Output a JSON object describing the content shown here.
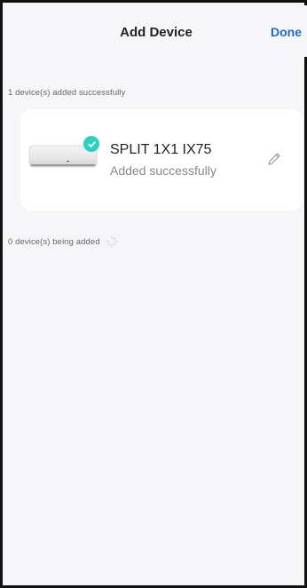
{
  "header": {
    "title": "Add Device",
    "done_label": "Done"
  },
  "success_section": {
    "label": "1 device(s) added successfully",
    "devices": [
      {
        "name": "SPLIT 1X1 IX75",
        "status": "Added successfully",
        "icon": "air-conditioner-icon"
      }
    ]
  },
  "adding_section": {
    "label": "0 device(s) being added"
  },
  "colors": {
    "accent": "#1f6cc8",
    "success": "#2fd0c0",
    "background": "#f6f6f8"
  }
}
